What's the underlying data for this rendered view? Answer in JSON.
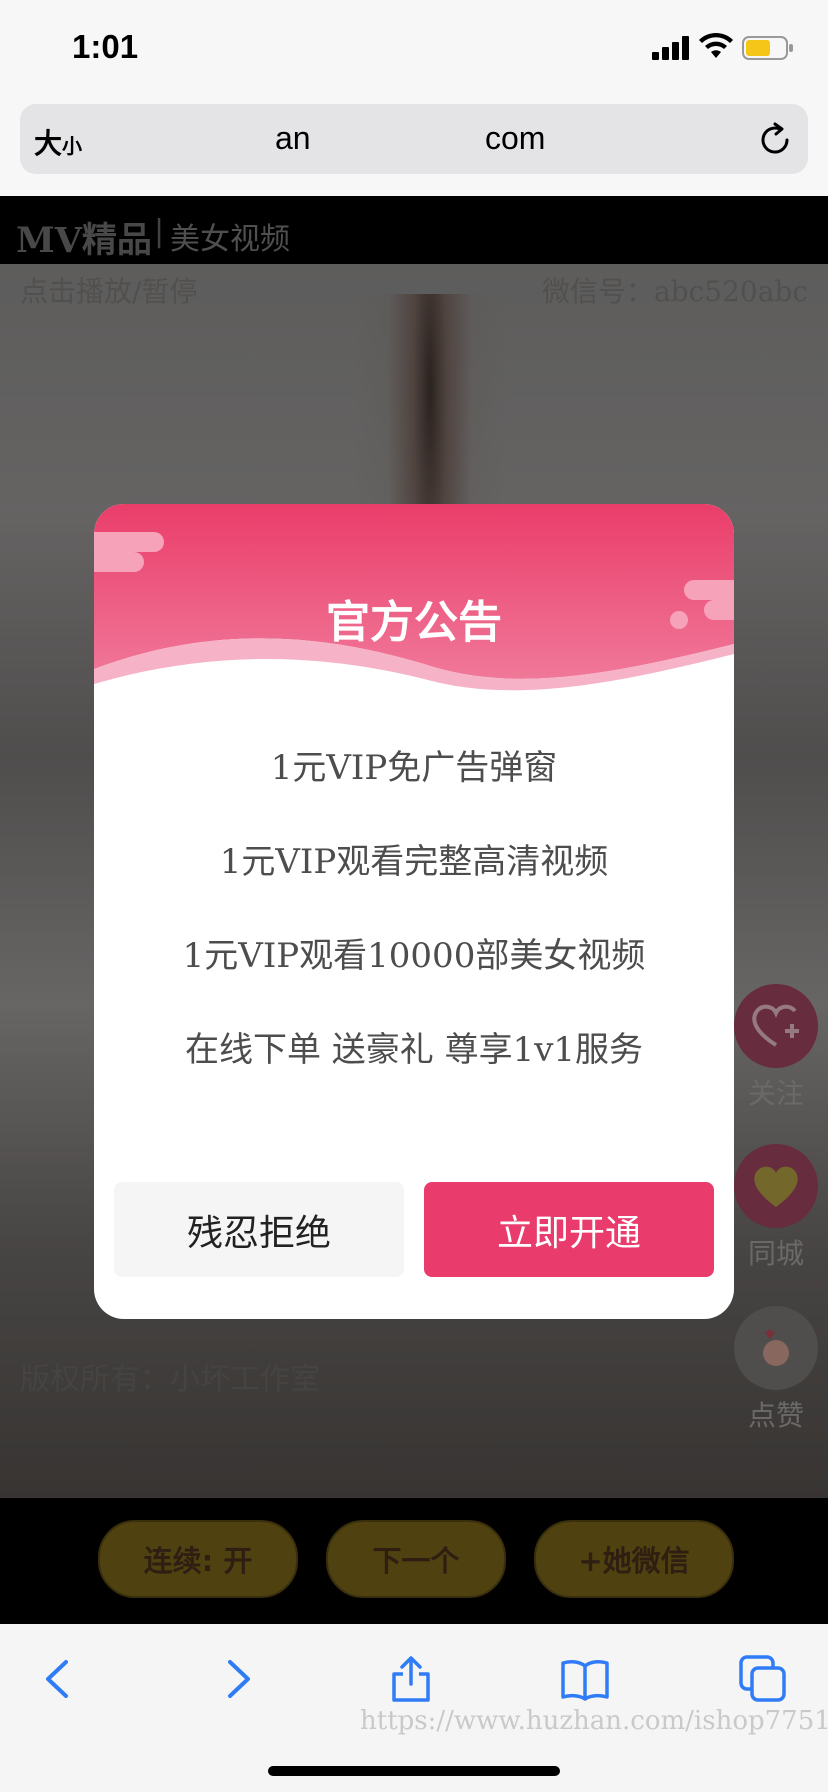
{
  "status": {
    "time": "1:01"
  },
  "browser": {
    "text_size": "大",
    "text_size_small": "小",
    "url_part1": "an",
    "url_part2": "com"
  },
  "site": {
    "brand": "MV精品",
    "separator": "|",
    "subtitle": "美女视频"
  },
  "video": {
    "play_hint": "点击播放/暂停",
    "wechat": "微信号：abc520abc",
    "copyright": "版权所有：小坏工作室"
  },
  "side_actions": [
    {
      "label": "关注",
      "icon": "heart-plus-icon"
    },
    {
      "label": "同城",
      "icon": "heart-icon"
    },
    {
      "label": "点赞",
      "icon": "finger-heart-icon"
    }
  ],
  "bottom_buttons": [
    {
      "label": "连续: 开"
    },
    {
      "label": "下一个"
    },
    {
      "label": "+她微信"
    }
  ],
  "modal": {
    "title": "官方公告",
    "lines": [
      "1元VIP免广告弹窗",
      "1元VIP观看完整高清视频",
      "1元VIP观看10000部美女视频",
      "在线下单 送豪礼 尊享1v1服务"
    ],
    "reject_label": "残忍拒绝",
    "open_label": "立即开通"
  },
  "watermark": "https://www.huzhan.com/ishop7751",
  "colors": {
    "accent_pink": "#e93c6c",
    "pill_gold": "#6b5716",
    "modal_header_pink": "#ec4a77"
  }
}
